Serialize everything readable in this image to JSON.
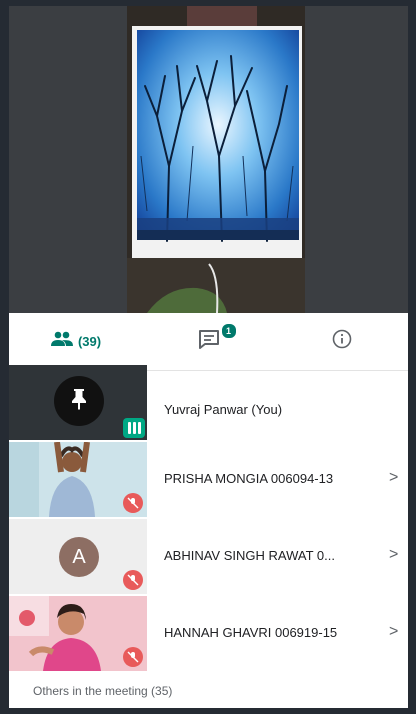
{
  "tabs": {
    "people_count": "(39)",
    "chat_badge": "1"
  },
  "participants": [
    {
      "name": "Yuvraj Panwar (You)"
    },
    {
      "name": "PRISHA MONGIA 006094-13",
      "chevron": ">"
    },
    {
      "name": "ABHINAV SINGH RAWAT 0...",
      "avatar_letter": "A",
      "chevron": ">"
    },
    {
      "name": "HANNAH GHAVRI 006919-15",
      "chevron": ">"
    }
  ],
  "others_label": "Others in the meeting (35)",
  "colors": {
    "accent": "#00796b",
    "mute_red": "#e85a5a",
    "avatar_brown": "#8d6e63"
  }
}
